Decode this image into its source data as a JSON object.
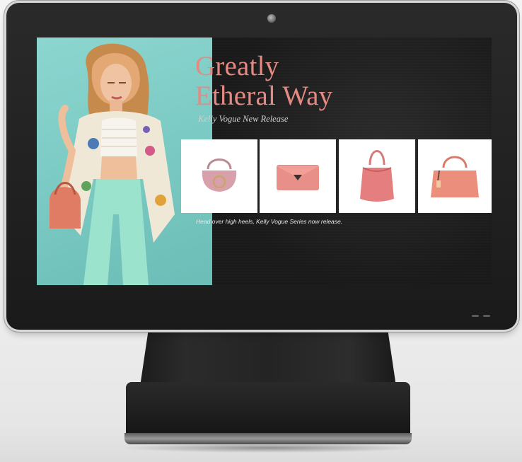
{
  "screen": {
    "headline_line1": "Greatly",
    "headline_line2": "Etheral Way",
    "subtitle": "Kelly Vogue New Release",
    "tagline": "Head over high heels, Kelly Vogue Series now release.",
    "accent_color": "#e58a82",
    "products": [
      {
        "name": "pink-saddle-bag-icon"
      },
      {
        "name": "coral-clutch-icon"
      },
      {
        "name": "pink-bucket-bag-icon"
      },
      {
        "name": "coral-tote-bag-icon"
      }
    ]
  },
  "device": {
    "camera": "camera-icon",
    "status_leds": 2
  }
}
